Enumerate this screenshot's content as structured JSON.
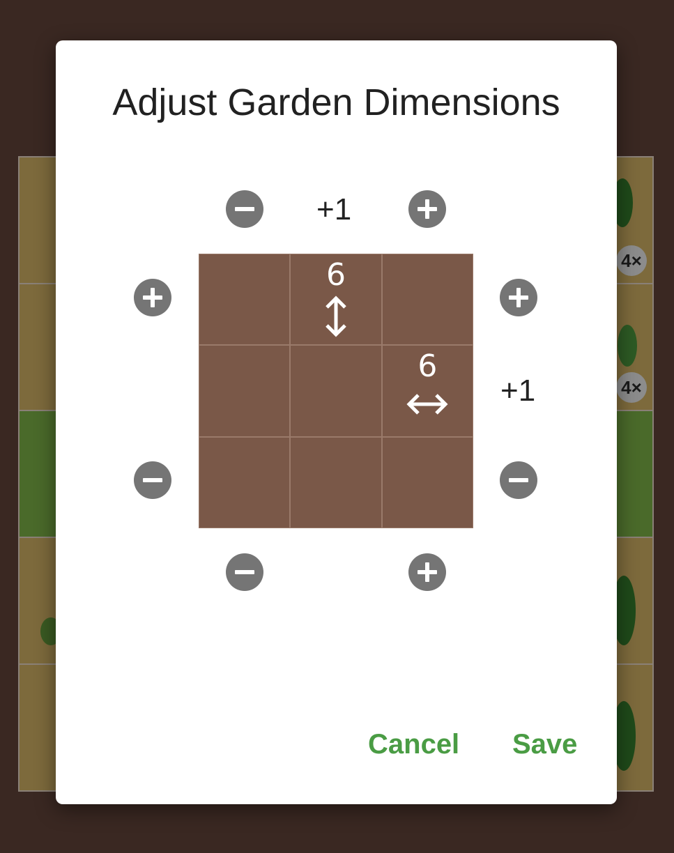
{
  "dialog": {
    "title": "Adjust Garden Dimensions",
    "top_delta": "+1",
    "right_delta": "+1",
    "height_value": "6",
    "width_value": "6",
    "cancel_label": "Cancel",
    "save_label": "Save"
  },
  "background": {
    "badges": [
      "4×",
      "4×"
    ]
  },
  "colors": {
    "plot_soil": "#7a5848",
    "button_gray": "#757575",
    "action_green": "#4a9c44",
    "backdrop": "#3a2822"
  }
}
